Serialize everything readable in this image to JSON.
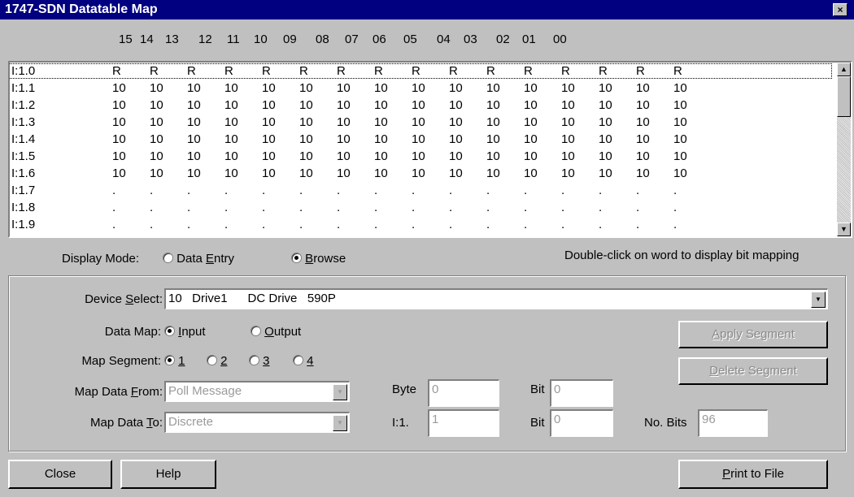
{
  "window": {
    "title": "1747-SDN Datatable Map",
    "close_glyph": "×"
  },
  "bit_headers": [
    "15",
    "14",
    "13",
    "12",
    "11",
    "10",
    "09",
    "08",
    "07",
    "06",
    "05",
    "04",
    "03",
    "02",
    "01",
    "00"
  ],
  "rows": [
    {
      "label": "I:1.0",
      "cells": [
        "R",
        "R",
        "R",
        "R",
        "R",
        "R",
        "R",
        "R",
        "R",
        "R",
        "R",
        "R",
        "R",
        "R",
        "R",
        "R"
      ]
    },
    {
      "label": "I:1.1",
      "cells": [
        "10",
        "10",
        "10",
        "10",
        "10",
        "10",
        "10",
        "10",
        "10",
        "10",
        "10",
        "10",
        "10",
        "10",
        "10",
        "10"
      ]
    },
    {
      "label": "I:1.2",
      "cells": [
        "10",
        "10",
        "10",
        "10",
        "10",
        "10",
        "10",
        "10",
        "10",
        "10",
        "10",
        "10",
        "10",
        "10",
        "10",
        "10"
      ]
    },
    {
      "label": "I:1.3",
      "cells": [
        "10",
        "10",
        "10",
        "10",
        "10",
        "10",
        "10",
        "10",
        "10",
        "10",
        "10",
        "10",
        "10",
        "10",
        "10",
        "10"
      ]
    },
    {
      "label": "I:1.4",
      "cells": [
        "10",
        "10",
        "10",
        "10",
        "10",
        "10",
        "10",
        "10",
        "10",
        "10",
        "10",
        "10",
        "10",
        "10",
        "10",
        "10"
      ]
    },
    {
      "label": "I:1.5",
      "cells": [
        "10",
        "10",
        "10",
        "10",
        "10",
        "10",
        "10",
        "10",
        "10",
        "10",
        "10",
        "10",
        "10",
        "10",
        "10",
        "10"
      ]
    },
    {
      "label": "I:1.6",
      "cells": [
        "10",
        "10",
        "10",
        "10",
        "10",
        "10",
        "10",
        "10",
        "10",
        "10",
        "10",
        "10",
        "10",
        "10",
        "10",
        "10"
      ]
    },
    {
      "label": "I:1.7",
      "cells": [
        ".",
        ".",
        ".",
        ".",
        ".",
        ".",
        ".",
        ".",
        ".",
        ".",
        ".",
        ".",
        ".",
        ".",
        ".",
        "."
      ]
    },
    {
      "label": "I:1.8",
      "cells": [
        ".",
        ".",
        ".",
        ".",
        ".",
        ".",
        ".",
        ".",
        ".",
        ".",
        ".",
        ".",
        ".",
        ".",
        ".",
        "."
      ]
    },
    {
      "label": "I:1.9",
      "cells": [
        ".",
        ".",
        ".",
        ".",
        ".",
        ".",
        ".",
        ".",
        ".",
        ".",
        ".",
        ".",
        ".",
        ".",
        ".",
        "."
      ]
    }
  ],
  "display_mode": {
    "label": "Display Mode:",
    "data_entry_pre": "Data ",
    "data_entry_key": "E",
    "data_entry_post": "ntry",
    "browse_key": "B",
    "browse_post": "rowse",
    "selected": "browse",
    "hint": "Double-click on word to display bit mapping"
  },
  "device_select": {
    "label_pre": "Device ",
    "label_key": "S",
    "label_post": "elect:",
    "value": "10   Drive1      DC Drive   590P"
  },
  "data_map": {
    "label": "Data Map:",
    "input_key": "I",
    "input_post": "nput",
    "output_key": "O",
    "output_post": "utput",
    "selected": "input"
  },
  "map_segment": {
    "label": "Map Segment:",
    "options": [
      "1",
      "2",
      "3",
      "4"
    ],
    "selected": "1"
  },
  "map_from": {
    "label_pre": "Map Data ",
    "label_key": "F",
    "label_post": "rom:",
    "value": "Poll Message"
  },
  "map_to": {
    "label_pre": "Map Data ",
    "label_key": "T",
    "label_post": "o:",
    "value": "Discrete"
  },
  "byte": {
    "label": "Byte",
    "value": "0"
  },
  "bit_from": {
    "label": "Bit",
    "value": "0"
  },
  "word": {
    "label": "I:1.",
    "value": "1"
  },
  "bit_to": {
    "label": "Bit",
    "value": "0"
  },
  "no_bits": {
    "label": "No. Bits",
    "value": "96"
  },
  "buttons": {
    "apply_key": "A",
    "apply_post": "pply Segment",
    "delete_key": "D",
    "delete_post": "elete Segment",
    "close": "Close",
    "help": "Help",
    "print_key": "P",
    "print_post": "rint to File"
  },
  "icons": {
    "dropdown": "▼",
    "scroll_up": "▲",
    "scroll_down": "▼"
  }
}
